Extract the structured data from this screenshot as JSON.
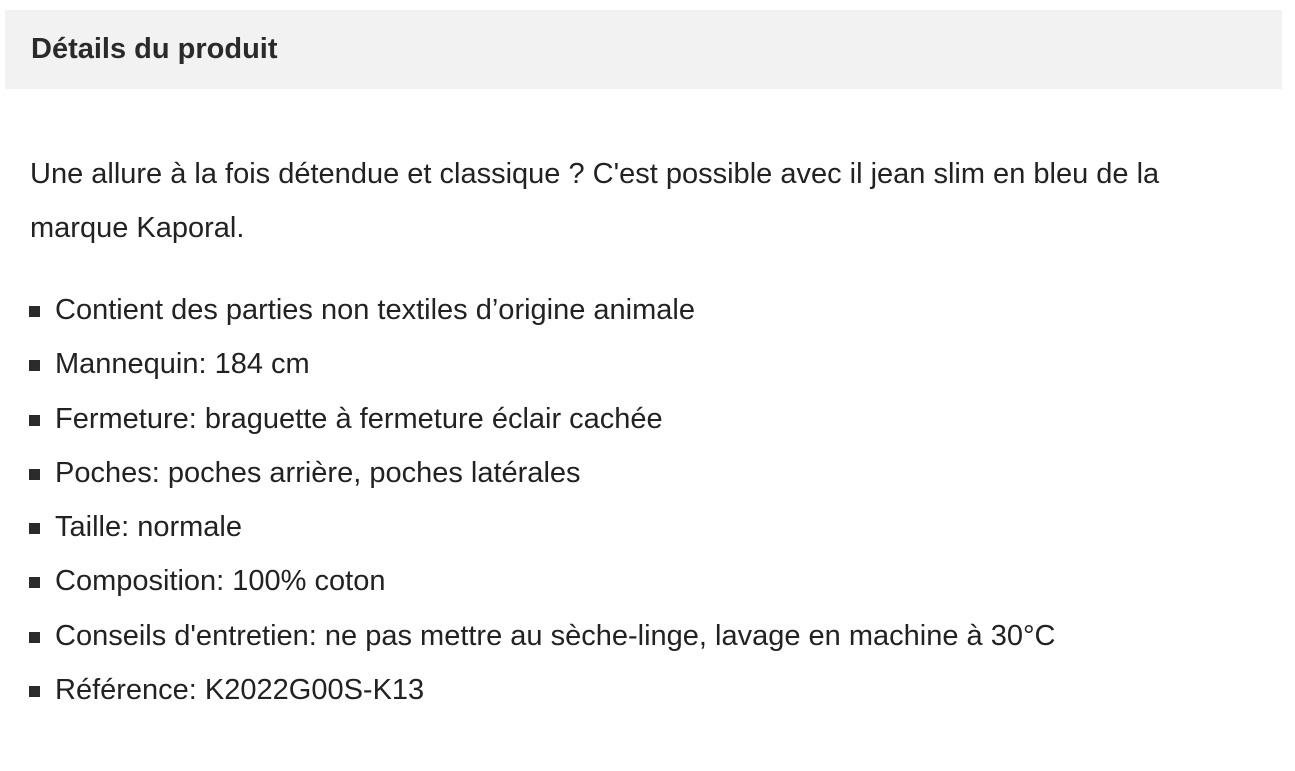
{
  "panel": {
    "title": "Détails du produit"
  },
  "description": "Une allure à la fois détendue et classique ? C'est possible avec il jean slim en bleu de la marque Kaporal.",
  "details": [
    "Contient des parties non textiles d’origine animale",
    "Mannequin: 184 cm",
    "Fermeture: braguette à fermeture éclair cachée",
    "Poches: poches arrière, poches latérales",
    "Taille: normale",
    "Composition: 100% coton",
    "Conseils d'entretien: ne pas mettre au sèche-linge, lavage en machine à 30°C",
    "Référence: K2022G00S-K13"
  ],
  "colors": {
    "header_background": "#f2f2f2",
    "text": "#222222",
    "bullet": "#2b2b2b"
  },
  "icons": {
    "bullet": "square-bullet-icon"
  }
}
